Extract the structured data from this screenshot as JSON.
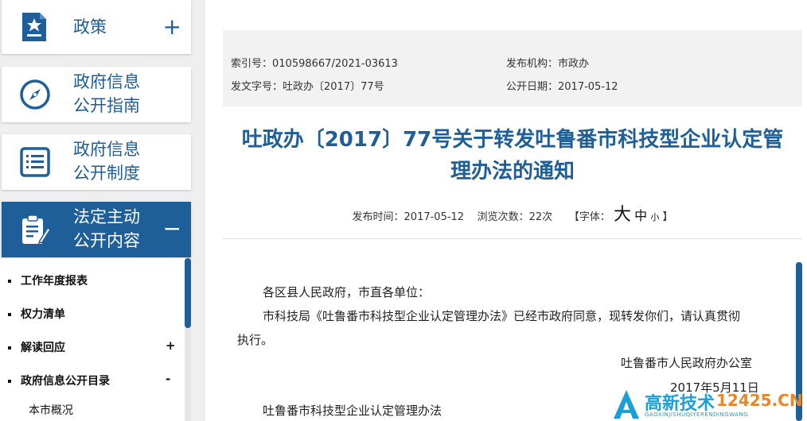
{
  "sidebar": {
    "items": [
      {
        "label_line1": "政策",
        "label_line2": "",
        "toggle": "+",
        "icon": "star-document-icon"
      },
      {
        "label_line1": "政府信息",
        "label_line2": "公开指南",
        "toggle": "",
        "icon": "compass-icon"
      },
      {
        "label_line1": "政府信息",
        "label_line2": "公开制度",
        "toggle": "",
        "icon": "list-document-icon"
      },
      {
        "label_line1": "法定主动",
        "label_line2": "公开内容",
        "toggle": "−",
        "icon": "clipboard-pen-icon"
      }
    ],
    "subitems": [
      {
        "label": "工作年度报表",
        "toggle": ""
      },
      {
        "label": "权力清单",
        "toggle": ""
      },
      {
        "label": "解读回应",
        "toggle": "+"
      },
      {
        "label": "政府信息公开目录",
        "toggle": "-"
      }
    ],
    "sub_child": "本市概况"
  },
  "meta": {
    "index_no": "索引号：010598667/2021-03613",
    "publisher": "发布机构：市政办",
    "doc_no": "发文字号：吐政办〔2017〕77号",
    "pub_date": "公开日期：2017-05-12"
  },
  "article": {
    "title_line1": "吐政办〔2017〕77号关于转发吐鲁番市科技型企业认定管",
    "title_line2": "理办法的通知",
    "publish_time": "发布时间：2017-05-12",
    "views": "浏览次数：22次",
    "font_label": "【字体：",
    "font_large": "大",
    "font_medium": "中",
    "font_small": "小",
    "font_close": "】",
    "salutation": "各区县人民政府，市直各单位：",
    "para1_line1": "市科技局《吐鲁番市科技型企业认定管理办法》已经市政府同意，现转发你们，请认真贯彻",
    "para1_line2": "执行。",
    "signature": "吐鲁番市人民政府办公室",
    "sign_date": "2017年5月11日",
    "attachment_title": "吐鲁番市科技型企业认定管理办法"
  },
  "watermark": {
    "brand": "高新技术",
    "domain": "12425.CN",
    "pinyin": "GAOXINJISHUQIYERENDINGWANG"
  },
  "colors": {
    "accent": "#1f5f99",
    "meta_bg": "#f2f2f2",
    "sidebar_bg": "#efefef"
  }
}
